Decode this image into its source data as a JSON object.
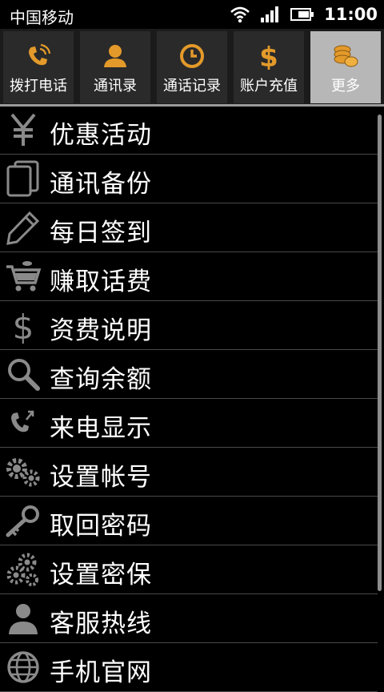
{
  "status_bar": {
    "carrier": "中国移动",
    "time": "11:00",
    "icons": [
      "wifi-icon",
      "signal-icon",
      "battery-icon"
    ]
  },
  "tabs": [
    {
      "label": "拨打电话",
      "icon": "phone-dial-icon",
      "active": false
    },
    {
      "label": "通讯录",
      "icon": "contacts-icon",
      "active": false
    },
    {
      "label": "通话记录",
      "icon": "call-log-clock-icon",
      "active": false
    },
    {
      "label": "账户充值",
      "icon": "dollar-icon",
      "active": false
    },
    {
      "label": "更多",
      "icon": "coins-icon",
      "active": true
    }
  ],
  "menu": {
    "items": [
      {
        "label": "优惠活动",
        "icon": "yen-icon"
      },
      {
        "label": "通讯备份",
        "icon": "backup-pages-icon"
      },
      {
        "label": "每日签到",
        "icon": "pencil-icon"
      },
      {
        "label": "赚取话费",
        "icon": "cart-icon"
      },
      {
        "label": "资费说明",
        "icon": "dollar-icon"
      },
      {
        "label": "查询余额",
        "icon": "search-icon"
      },
      {
        "label": "来电显示",
        "icon": "incoming-call-icon"
      },
      {
        "label": "设置帐号",
        "icon": "gears-icon"
      },
      {
        "label": "取回密码",
        "icon": "key-icon"
      },
      {
        "label": "设置密保",
        "icon": "gears-security-icon"
      },
      {
        "label": "客服热线",
        "icon": "person-icon"
      },
      {
        "label": "手机官网",
        "icon": "globe-icon"
      }
    ]
  },
  "colors": {
    "accent_icon": "#e39a2a",
    "active_tab_bg": "#b7b7b7",
    "menu_icon": "#8a8a8a"
  }
}
